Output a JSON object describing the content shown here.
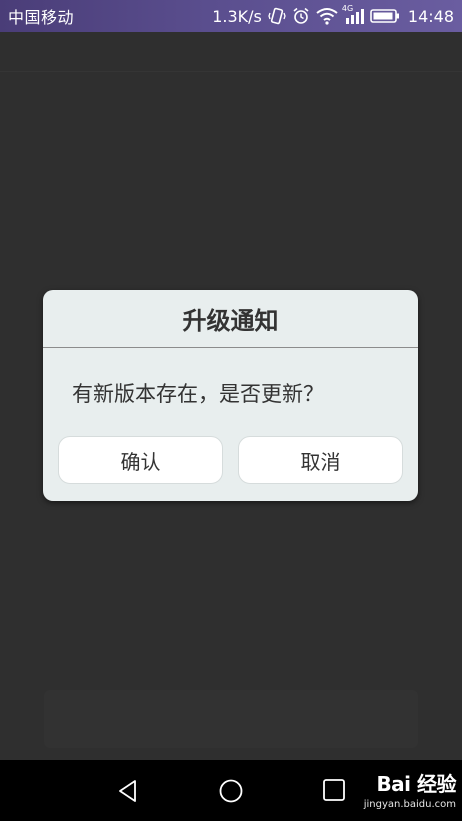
{
  "status_bar": {
    "carrier": "中国移动",
    "network_speed": "1.3K/s",
    "network_type": "4G",
    "time": "14:48",
    "icons": [
      "vibrate-icon",
      "alarm-icon",
      "wifi-icon",
      "signal-icon",
      "battery-icon"
    ]
  },
  "dialog": {
    "title": "升级通知",
    "message": "有新版本存在，是否更新？",
    "confirm_label": "确认",
    "cancel_label": "取消"
  },
  "nav_bar": {
    "icons": [
      "back-icon",
      "home-icon",
      "recents-icon"
    ]
  },
  "watermark": {
    "logo_text": "Bai 经验",
    "url": "jingyan.baidu.com"
  },
  "colors": {
    "background": "#2f2f2f",
    "status_bar": "#5a4e8e",
    "dialog_bg": "#e8eeee",
    "button_bg": "#ffffff",
    "text": "#333333",
    "nav_bar": "#000000"
  }
}
